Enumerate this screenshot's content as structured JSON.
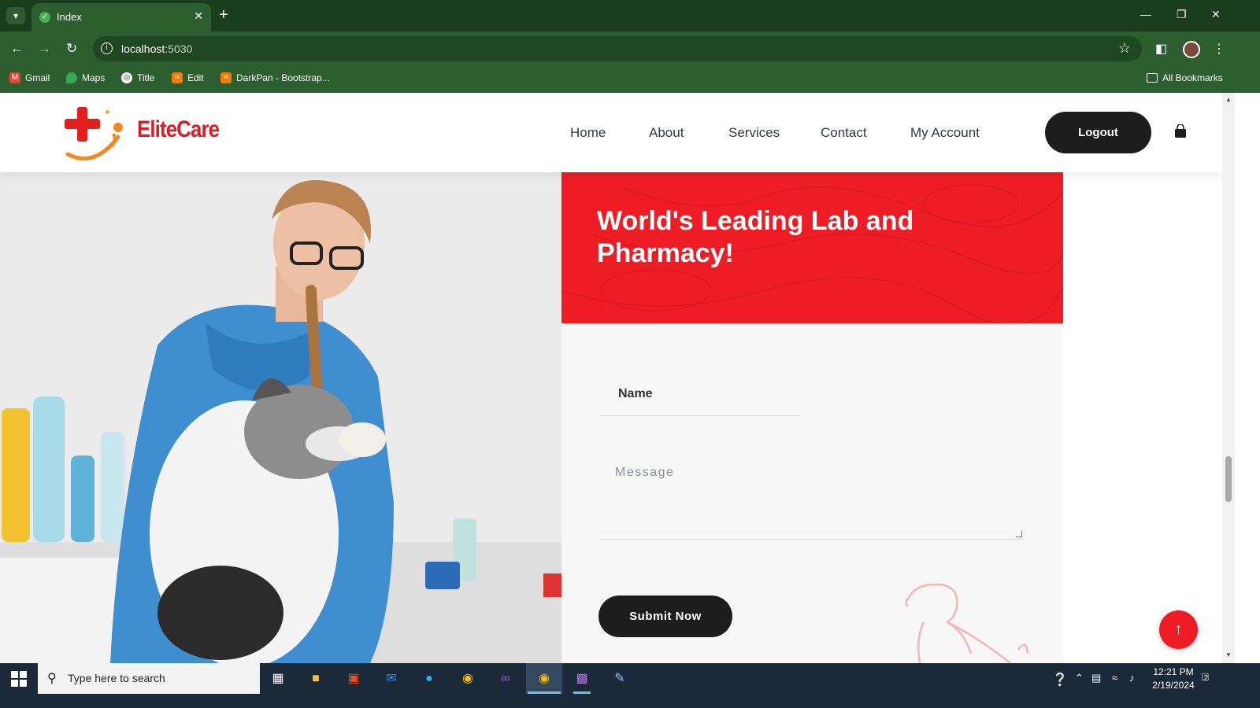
{
  "browser": {
    "tab_title": "Index",
    "url_host": "localhost",
    "url_port": ":5030",
    "bookmarks": [
      "Gmail",
      "Maps",
      "Title",
      "Edit",
      "DarkPan - Bootstrap..."
    ],
    "all_bookmarks": "All Bookmarks"
  },
  "site": {
    "brand": "EliteCare",
    "nav": [
      "Home",
      "About",
      "Services",
      "Contact",
      "My Account"
    ],
    "logout_label": "Logout"
  },
  "hero": {
    "title": "World's Leading Lab and Pharmacy!"
  },
  "form": {
    "name_label": "Name",
    "message_placeholder": "Message",
    "submit_label": "Submit Now"
  },
  "colors": {
    "brand_red": "#ee1c25",
    "dark_button": "#1d1d1d",
    "browser_green": "#2d5e2f"
  },
  "taskbar": {
    "search_placeholder": "Type here to search",
    "time": "12:21 PM",
    "date": "2/19/2024",
    "notification_count": "2"
  }
}
